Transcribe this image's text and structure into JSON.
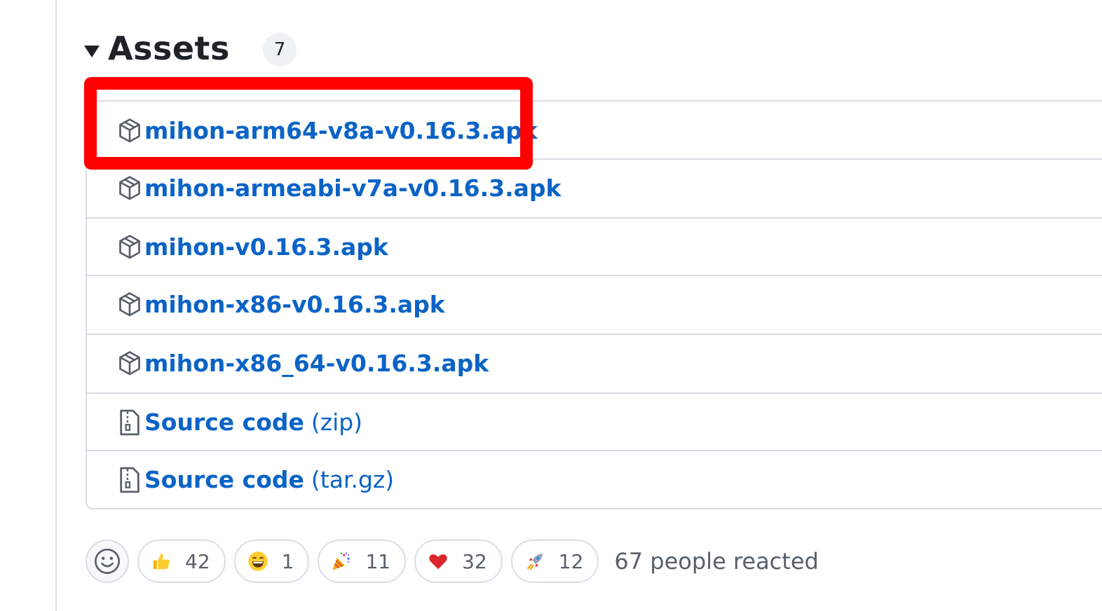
{
  "assets": {
    "title": "Assets",
    "count": "7",
    "items": [
      {
        "name": "mihon-arm64-v8a-v0.16.3.apk",
        "suffix": "",
        "icon": "package-icon"
      },
      {
        "name": "mihon-armeabi-v7a-v0.16.3.apk",
        "suffix": "",
        "icon": "package-icon"
      },
      {
        "name": "mihon-v0.16.3.apk",
        "suffix": "",
        "icon": "package-icon"
      },
      {
        "name": "mihon-x86-v0.16.3.apk",
        "suffix": "",
        "icon": "package-icon"
      },
      {
        "name": "mihon-x86_64-v0.16.3.apk",
        "suffix": "",
        "icon": "package-icon"
      },
      {
        "name": "Source code",
        "suffix": "(zip)",
        "icon": "file-zip-icon"
      },
      {
        "name": "Source code",
        "suffix": "(tar.gz)",
        "icon": "file-zip-icon"
      }
    ]
  },
  "reactions": {
    "items": [
      {
        "emoji": "thumbs-up",
        "count": "42"
      },
      {
        "emoji": "smile",
        "count": "1"
      },
      {
        "emoji": "party-popper",
        "count": "11"
      },
      {
        "emoji": "heart",
        "count": "32"
      },
      {
        "emoji": "rocket",
        "count": "12"
      }
    ],
    "summary": "67 people reacted"
  },
  "colors": {
    "link": "#0b63c6",
    "highlight": "#ff0000",
    "border": "#d8dee4"
  }
}
